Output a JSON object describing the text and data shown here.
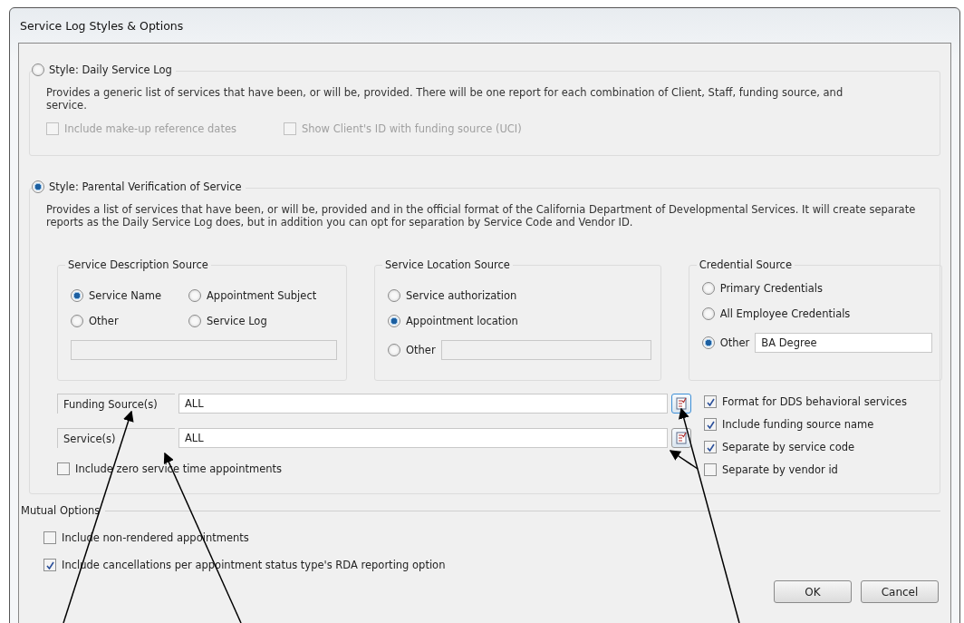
{
  "window": {
    "title": "Service Log Styles & Options"
  },
  "styles": [
    {
      "label": "Style: Daily Service Log",
      "selected": false,
      "description": "Provides a generic list of services that have been, or will be, provided. There will be one report for each combination of Client, Staff, funding source, and service.",
      "options": [
        {
          "label": "Include make-up reference dates",
          "checked": false,
          "disabled": true
        },
        {
          "label": "Show Client's ID with funding source (UCI)",
          "checked": false,
          "disabled": true
        }
      ]
    },
    {
      "label": "Style: Parental Verification of Service",
      "selected": true,
      "description": "Provides a list of services that have been, or will be, provided and in the official format of the California Department of Developmental Services. It will create separate reports as the Daily Service Log does, but in addition you can opt for separation by Service Code and Vendor ID."
    }
  ],
  "service_description_source": {
    "title": "Service Description Source",
    "options": [
      {
        "label": "Service Name",
        "selected": true
      },
      {
        "label": "Appointment Subject",
        "selected": false
      },
      {
        "label": "Other",
        "selected": false
      },
      {
        "label": "Service Log",
        "selected": false
      }
    ]
  },
  "service_location_source": {
    "title": "Service Location Source",
    "options": [
      {
        "label": "Service authorization",
        "selected": false
      },
      {
        "label": "Appointment location",
        "selected": true
      },
      {
        "label": "Other",
        "selected": false
      }
    ]
  },
  "credential_source": {
    "title": "Credential Source",
    "options": [
      {
        "label": "Primary Credentials",
        "selected": false
      },
      {
        "label": "All Employee Credentials",
        "selected": false
      },
      {
        "label": "Other",
        "selected": true,
        "value": "BA Degree"
      }
    ]
  },
  "filters": [
    {
      "label": "Funding Source(s)",
      "value": "ALL",
      "focused": true
    },
    {
      "label": "Service(s)",
      "value": "ALL",
      "focused": false
    }
  ],
  "zero_time": {
    "label": "Include zero service time appointments",
    "checked": false
  },
  "format_options": [
    {
      "label": "Format for DDS behavioral services",
      "checked": true
    },
    {
      "label": "Include funding source name",
      "checked": true
    },
    {
      "label": "Separate by service code",
      "checked": true
    },
    {
      "label": "Separate by vendor id",
      "checked": false
    }
  ],
  "mutual_options": {
    "title": "Mutual Options",
    "options": [
      {
        "label": "Include non-rendered appointments",
        "checked": false
      },
      {
        "label": "Include cancellations per appointment status type's RDA reporting option",
        "checked": true
      }
    ]
  },
  "buttons": [
    "OK",
    "Cancel"
  ]
}
